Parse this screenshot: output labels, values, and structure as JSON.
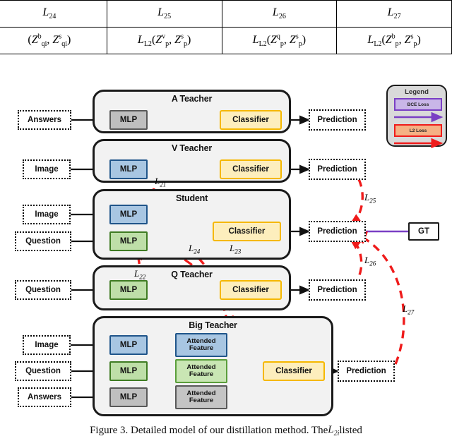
{
  "table": {
    "columns": [
      {
        "header": "L",
        "header_sub": "24",
        "body_prefix": "(",
        "body": "Z b qi , Z s qi )"
      },
      {
        "header": "L",
        "header_sub": "25",
        "body": "L_L2( Z v p , Z s p )"
      },
      {
        "header": "L",
        "header_sub": "26",
        "body": "L_L2( Z q p , Z s p )"
      },
      {
        "header": "L",
        "header_sub": "27",
        "body": "L_L2( Z b p , Z s p )"
      }
    ],
    "cells": [
      {
        "h_base": "L",
        "h_sub": "24",
        "b_kind": "partial",
        "b_fn": "",
        "b_a_base": "Z",
        "b_a_sup": "b",
        "b_a_sub": "qi",
        "b_b_base": "Z",
        "b_b_sup": "s",
        "b_b_sub": "qi"
      },
      {
        "h_base": "L",
        "h_sub": "25",
        "b_kind": "full",
        "b_fn": "L",
        "b_fn_sub": "L2",
        "b_a_base": "Z",
        "b_a_sup": "v",
        "b_a_sub": "p",
        "b_b_base": "Z",
        "b_b_sup": "s",
        "b_b_sub": "p"
      },
      {
        "h_base": "L",
        "h_sub": "26",
        "b_kind": "full",
        "b_fn": "L",
        "b_fn_sub": "L2",
        "b_a_base": "Z",
        "b_a_sup": "q",
        "b_a_sub": "p",
        "b_b_base": "Z",
        "b_b_sup": "s",
        "b_b_sub": "p"
      },
      {
        "h_base": "L",
        "h_sub": "27",
        "b_kind": "full",
        "b_fn": "L",
        "b_fn_sub": "L2",
        "b_a_base": "Z",
        "b_a_sup": "b",
        "b_a_sub": "p",
        "b_b_base": "Z",
        "b_b_sup": "s",
        "b_b_sub": "p"
      }
    ]
  },
  "panels": {
    "a_teacher": {
      "title": "A Teacher"
    },
    "v_teacher": {
      "title": "V Teacher"
    },
    "student": {
      "title": "Student"
    },
    "q_teacher": {
      "title": "Q Teacher"
    },
    "big_teacher": {
      "title": "Big Teacher"
    }
  },
  "inputs": {
    "answers": "Answers",
    "image": "Image",
    "question": "Question"
  },
  "nodes": {
    "mlp": "MLP",
    "classifier": "Classifier",
    "attended_feature_line1": "Attended",
    "attended_feature_line2": "Feature",
    "prediction": "Prediction",
    "gt": "GT"
  },
  "legend": {
    "title": "Legend",
    "bce_label": "BCE Loss",
    "l2_label": "L2 Loss",
    "bce_color": "#7a3fc4",
    "bce_fill": "#c9b6e8",
    "l2_color": "#ef1b1b",
    "l2_fill": "#f5b184"
  },
  "loss_labels": {
    "l21": {
      "base": "L",
      "sub": "21"
    },
    "l22": {
      "base": "L",
      "sub": "22"
    },
    "l23": {
      "base": "L",
      "sub": "23"
    },
    "l24": {
      "base": "L",
      "sub": "24"
    },
    "l25": {
      "base": "L",
      "sub": "25"
    },
    "l26": {
      "base": "L",
      "sub": "26"
    },
    "l27": {
      "base": "L",
      "sub": "27"
    }
  },
  "caption": {
    "text_before": "Figure 3. Detailed model of our distillation method. The ",
    "math_base": "L",
    "math_sub": "2i",
    "text_after": " listed"
  },
  "colors": {
    "panel_fill": "#f2f2f2",
    "panel_border": "#1a1a1a",
    "mlp_grey": "#bfbfbf",
    "mlp_blue": "#a8c6e2",
    "mlp_green": "#bedfa8",
    "classifier_fill": "#fdeebd",
    "classifier_border": "#f5b800",
    "red_loss": "#ef1b1b",
    "purple_loss": "#7a3fc4"
  }
}
